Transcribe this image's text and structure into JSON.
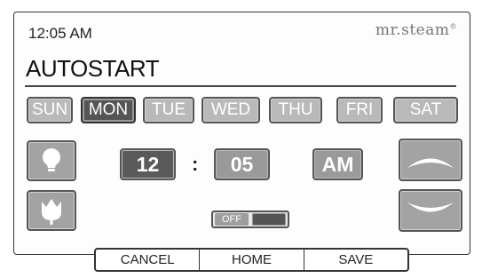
{
  "header": {
    "time": "12:05 AM",
    "brand": "mr.steam",
    "brand_mark": "®"
  },
  "page": {
    "title": "AUTOSTART"
  },
  "days": [
    {
      "label": "SUN",
      "selected": false
    },
    {
      "label": "MON",
      "selected": true
    },
    {
      "label": "TUE",
      "selected": false
    },
    {
      "label": "WED",
      "selected": false
    },
    {
      "label": "THU",
      "selected": false
    },
    {
      "label": "FRI",
      "selected": false
    },
    {
      "label": "SAT",
      "selected": false
    }
  ],
  "time_setting": {
    "hour": "12",
    "separator": ":",
    "minute": "05",
    "meridiem": "AM"
  },
  "toggle": {
    "label": "OFF"
  },
  "icons": {
    "light": "lightbulb-icon",
    "aroma": "flower-icon",
    "up": "arrow-up-icon",
    "down": "arrow-down-icon"
  },
  "footer": {
    "cancel": "CANCEL",
    "home": "HOME",
    "save": "SAVE"
  },
  "colors": {
    "button_gray": "#a3a3a3",
    "active_gray": "#555555",
    "value_dark": "#5a5a5a",
    "ampm_gray": "#9a9a9a"
  }
}
